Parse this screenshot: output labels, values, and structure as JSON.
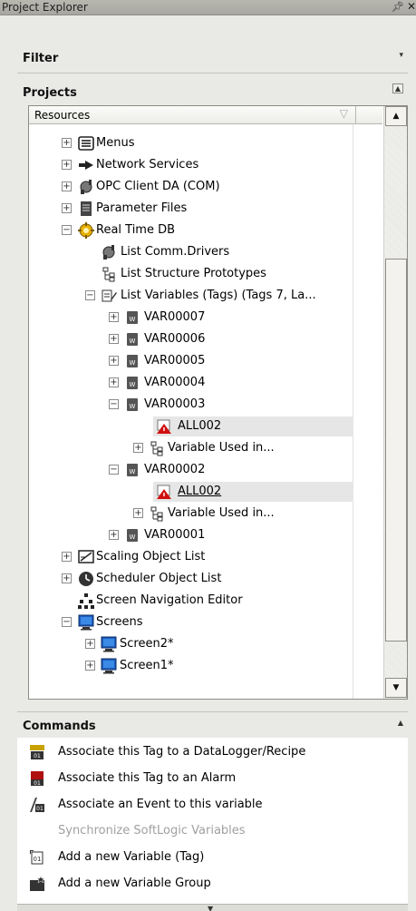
{
  "window": {
    "title": "Project Explorer",
    "pin_icon": "pin-icon",
    "close_icon": "close-icon"
  },
  "filter": {
    "label": "Filter"
  },
  "projects": {
    "label": "Projects"
  },
  "tree": {
    "column_header": "Resources",
    "rows": [
      {
        "label": "Menus"
      },
      {
        "label": "Network Services"
      },
      {
        "label": "OPC Client DA (COM)"
      },
      {
        "label": "Parameter Files"
      },
      {
        "label": "Real Time DB"
      },
      {
        "label": "List Comm.Drivers"
      },
      {
        "label": "List Structure Prototypes"
      },
      {
        "label": "List Variables (Tags) (Tags 7, La..."
      },
      {
        "label": "VAR00007"
      },
      {
        "label": "VAR00006"
      },
      {
        "label": "VAR00005"
      },
      {
        "label": "VAR00004"
      },
      {
        "label": "VAR00003"
      },
      {
        "label": "ALL002"
      },
      {
        "label": "Variable Used in..."
      },
      {
        "label": "VAR00002"
      },
      {
        "label": "ALL002"
      },
      {
        "label": "Variable Used in..."
      },
      {
        "label": "VAR00001"
      },
      {
        "label": "Scaling Object List"
      },
      {
        "label": "Scheduler Object List"
      },
      {
        "label": "Screen Navigation Editor"
      },
      {
        "label": "Screens"
      },
      {
        "label": "Screen2*"
      },
      {
        "label": "Screen1*"
      }
    ]
  },
  "commands": {
    "label": "Commands",
    "items": [
      {
        "label": "Associate this Tag to a DataLogger/Recipe"
      },
      {
        "label": "Associate this Tag to an Alarm"
      },
      {
        "label": "Associate an Event to this variable"
      },
      {
        "label": "Synchronize SoftLogic Variables"
      },
      {
        "label": "Add a new Variable (Tag)"
      },
      {
        "label": "Add a new Variable Group"
      }
    ]
  }
}
